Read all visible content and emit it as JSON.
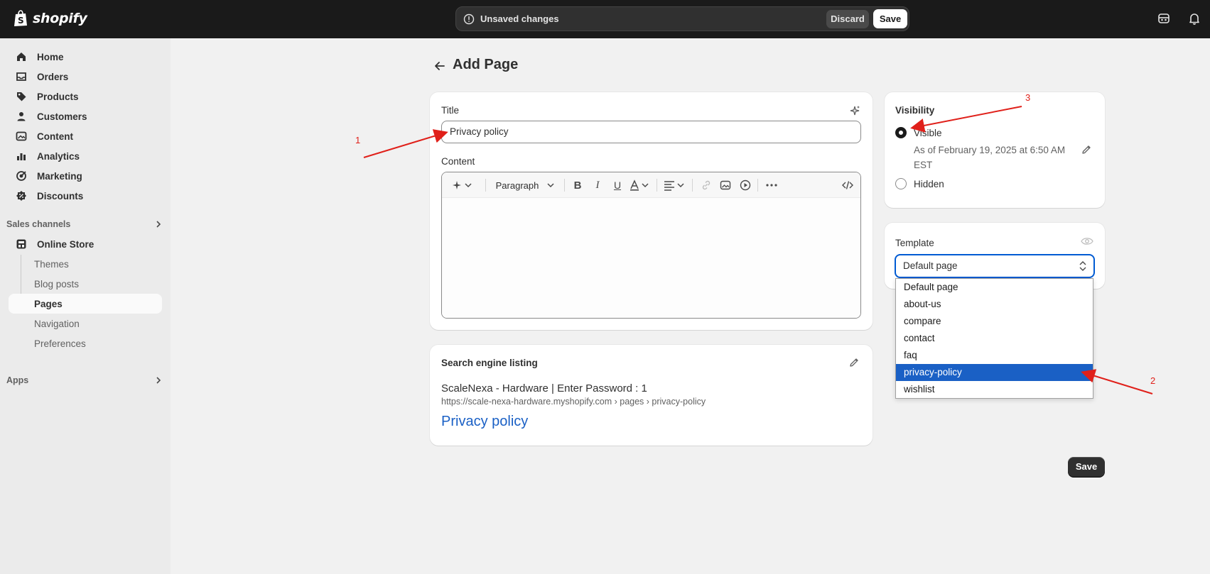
{
  "brand": {
    "name": "shopify"
  },
  "topbar": {
    "unsaved_text": "Unsaved changes",
    "discard_label": "Discard",
    "save_label": "Save"
  },
  "sidebar": {
    "items": [
      {
        "label": "Home",
        "icon": "home-icon"
      },
      {
        "label": "Orders",
        "icon": "inbox-icon"
      },
      {
        "label": "Products",
        "icon": "tag-icon"
      },
      {
        "label": "Customers",
        "icon": "person-icon"
      },
      {
        "label": "Content",
        "icon": "image-icon"
      },
      {
        "label": "Analytics",
        "icon": "bar-chart-icon"
      },
      {
        "label": "Marketing",
        "icon": "target-icon"
      },
      {
        "label": "Discounts",
        "icon": "discount-icon"
      }
    ],
    "sales_channels_label": "Sales channels",
    "online_store_label": "Online Store",
    "sub_items": [
      {
        "label": "Themes"
      },
      {
        "label": "Blog posts"
      },
      {
        "label": "Pages",
        "active": true
      },
      {
        "label": "Navigation"
      },
      {
        "label": "Preferences"
      }
    ],
    "apps_label": "Apps"
  },
  "page": {
    "title": "Add Page"
  },
  "main_card": {
    "title_label": "Title",
    "title_value": "Privacy policy",
    "content_label": "Content",
    "paragraph_label": "Paragraph"
  },
  "seo": {
    "heading": "Search engine listing",
    "page_title": "ScaleNexa - Hardware | Enter Password : 1",
    "url": "https://scale-nexa-hardware.myshopify.com › pages › privacy-policy",
    "link_text": "Privacy policy"
  },
  "visibility": {
    "heading": "Visibility",
    "visible_label": "Visible",
    "visible_date_line1": "As of February 19, 2025 at 6:50 AM",
    "visible_date_line2": "EST",
    "hidden_label": "Hidden",
    "selected": "Visible"
  },
  "template": {
    "heading": "Template",
    "selected_value": "Default page",
    "options": [
      "Default page",
      "about-us",
      "compare",
      "contact",
      "faq",
      "privacy-policy",
      "wishlist"
    ],
    "highlighted": "privacy-policy"
  },
  "footer": {
    "save_label": "Save"
  },
  "annotations": {
    "a1": "1",
    "a2": "2",
    "a3": "3",
    "color": "#e0201a"
  },
  "colors": {
    "accent": "#005bd3",
    "link": "#1a60c5",
    "dark": "#1a1a1a"
  }
}
